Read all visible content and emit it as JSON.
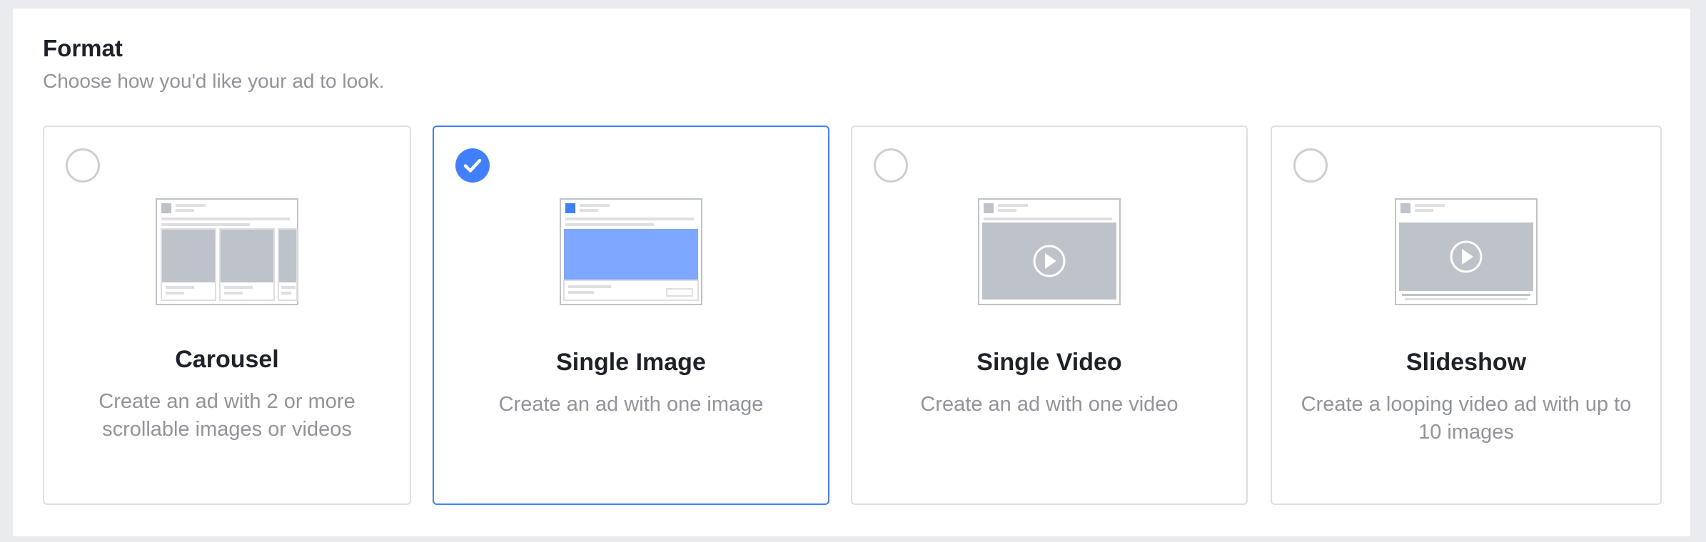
{
  "format": {
    "title": "Format",
    "subtitle": "Choose how you'd like your ad to look."
  },
  "options": [
    {
      "title": "Carousel",
      "description": "Create an ad with 2 or more scrollable images or videos",
      "selected": false,
      "icon": "carousel-preview-icon"
    },
    {
      "title": "Single Image",
      "description": "Create an ad with one image",
      "selected": true,
      "icon": "single-image-preview-icon"
    },
    {
      "title": "Single Video",
      "description": "Create an ad with one video",
      "selected": false,
      "icon": "single-video-preview-icon"
    },
    {
      "title": "Slideshow",
      "description": "Create a looping video ad with up to 10 images",
      "selected": false,
      "icon": "slideshow-preview-icon"
    }
  ],
  "colors": {
    "accent": "#4080ff",
    "border": "#dddfe2",
    "placeholder": "#bec3c9",
    "text": "#1d2129",
    "muted": "#90949c"
  }
}
